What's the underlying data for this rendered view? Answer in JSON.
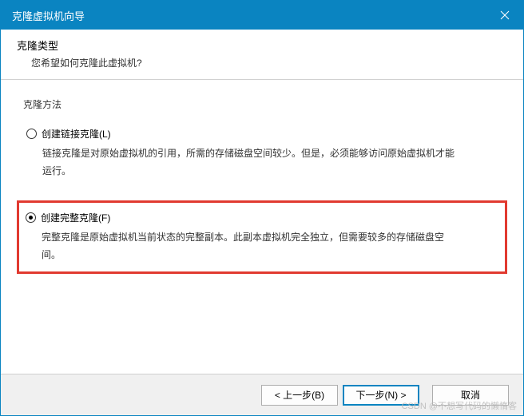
{
  "titlebar": {
    "title": "克隆虚拟机向导"
  },
  "header": {
    "title": "克隆类型",
    "subtitle": "您希望如何克隆此虚拟机?"
  },
  "group_label": "克隆方法",
  "options": {
    "linked": {
      "label": "创建链接克隆(L)",
      "desc": "链接克隆是对原始虚拟机的引用，所需的存储磁盘空间较少。但是，必须能够访问原始虚拟机才能运行。",
      "selected": false
    },
    "full": {
      "label": "创建完整克隆(F)",
      "desc": "完整克隆是原始虚拟机当前状态的完整副本。此副本虚拟机完全独立，但需要较多的存储磁盘空间。",
      "selected": true
    }
  },
  "footer": {
    "back": "< 上一步(B)",
    "next": "下一步(N) >",
    "cancel": "取消"
  },
  "watermark": "CSDN @不想写代码的懒惰客"
}
